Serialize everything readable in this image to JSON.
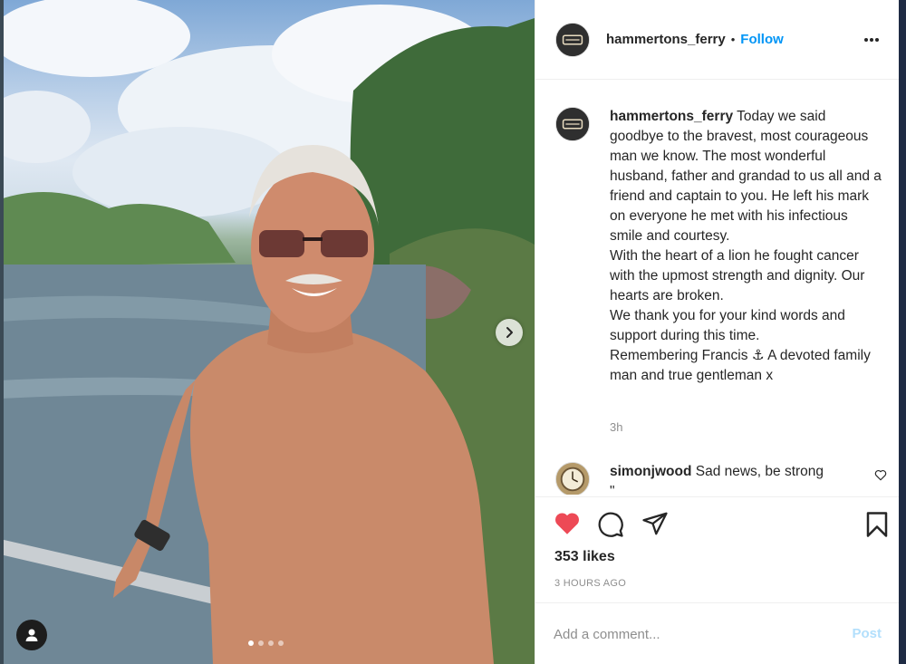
{
  "post": {
    "username": "hammertons_ferry",
    "separator": "•",
    "follow_label": "Follow",
    "caption_lines": [
      "Today we said goodbye to the bravest, most courageous man we know. The most wonderful husband, father and grandad to us all and a friend and captain to you. He left his mark on everyone he met with his infectious smile and courtesy.",
      "With the heart of a lion he fought cancer with the upmost strength and dignity. Our hearts are broken.",
      "We thank you for your kind words and support during this time.",
      "Remembering Francis ⚓ A devoted family man and true gentleman x"
    ],
    "time_ago": "3h",
    "likes": "353 likes",
    "posted_ago": "3 HOURS AGO"
  },
  "comments": [
    {
      "username": "simonjwood",
      "text": "Sad news, be strong",
      "overflow": "\""
    }
  ],
  "add_comment": {
    "placeholder": "Add a comment...",
    "post_label": "Post"
  },
  "carousel": {
    "slide_count": 4,
    "active_index": 0
  },
  "icons": {
    "header_more": "more-horizontal-icon",
    "like": "heart-filled-icon",
    "comment": "comment-bubble-icon",
    "share": "paper-plane-icon",
    "save": "bookmark-icon",
    "next": "chevron-right-icon",
    "user_tag": "person-icon"
  },
  "colors": {
    "accent": "#0095f6",
    "like": "#ed4956",
    "post_disabled": "#b2dffc",
    "muted": "#8e8e8e"
  }
}
